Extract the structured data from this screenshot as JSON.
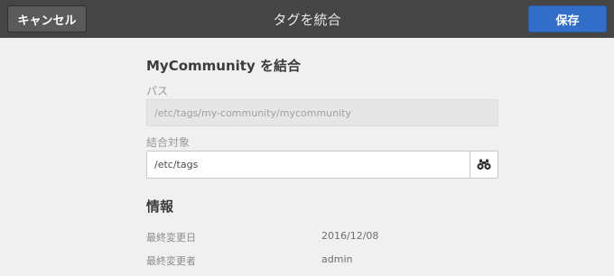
{
  "header": {
    "cancel_label": "キャンセル",
    "title": "タグを統合",
    "save_label": "保存"
  },
  "form": {
    "heading": "MyCommunity を結合",
    "path_label": "パス",
    "path_value": "/etc/tags/my-community/mycommunity",
    "target_label": "結合対象",
    "target_value": "/etc/tags",
    "browse_icon": "binoculars-icon"
  },
  "info": {
    "heading": "情報",
    "rows": [
      {
        "key": "最終変更日",
        "value": "2016/12/08"
      },
      {
        "key": "最終変更者",
        "value": "admin"
      }
    ]
  },
  "colors": {
    "topbar": "#454545",
    "save_button": "#326ec8",
    "background": "#f0f0f0"
  }
}
